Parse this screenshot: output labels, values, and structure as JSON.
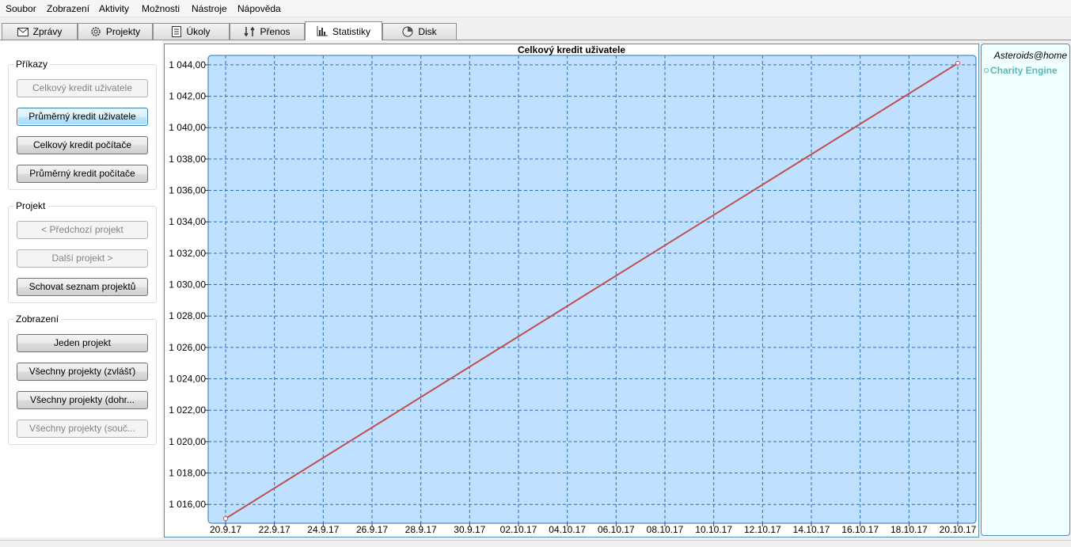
{
  "menu": [
    "Soubor",
    "Zobrazení",
    "Aktivity",
    "Možnosti",
    "Nástroje",
    "Nápověda"
  ],
  "tabs": [
    {
      "label": "Zprávy",
      "icon": "envelope-icon"
    },
    {
      "label": "Projekty",
      "icon": "gear-icon"
    },
    {
      "label": "Úkoly",
      "icon": "task-list-icon"
    },
    {
      "label": "Přenos",
      "icon": "transfer-icon"
    },
    {
      "label": "Statistiky",
      "icon": "bar-chart-icon",
      "active": true
    },
    {
      "label": "Disk",
      "icon": "disk-icon"
    }
  ],
  "commands": {
    "title": "Příkazy",
    "buttons": [
      {
        "label": "Celkový kredit uživatele",
        "state": "disabled"
      },
      {
        "label": "Průměrný kredit uživatele",
        "state": "focused"
      },
      {
        "label": "Celkový kredit počítače",
        "state": "normal"
      },
      {
        "label": "Průměrný kredit počítače",
        "state": "normal"
      }
    ]
  },
  "project": {
    "title": "Projekt",
    "buttons": [
      {
        "label": "< Předchozí projekt",
        "state": "disabled"
      },
      {
        "label": "Další projekt >",
        "state": "disabled"
      },
      {
        "label": "Schovat seznam projektů",
        "state": "normal"
      }
    ]
  },
  "view": {
    "title": "Zobrazení",
    "buttons": [
      {
        "label": "Jeden projekt",
        "state": "normal"
      },
      {
        "label": "Všechny projekty (zvlášť)",
        "state": "normal"
      },
      {
        "label": "Všechny projekty (dohr...",
        "state": "normal"
      },
      {
        "label": "Všechny projekty (souč...",
        "state": "disabled"
      }
    ]
  },
  "legend": {
    "project_name": "Asteroids@home",
    "items": [
      "Charity Engine"
    ]
  },
  "colors": {
    "plot_bg": "#bfe0ff",
    "grid": "#2f6fb3",
    "line": "#c0504d",
    "legend_text": "#5bb7b4"
  },
  "chart_data": {
    "type": "line",
    "title": "Celkový kredit uživatele",
    "xlabel": "",
    "ylabel": "",
    "x_tick_labels": [
      "20.9.17",
      "22.9.17",
      "24.9.17",
      "26.9.17",
      "28.9.17",
      "30.9.17",
      "02.10.17",
      "04.10.17",
      "06.10.17",
      "08.10.17",
      "10.10.17",
      "12.10.17",
      "14.10.17",
      "16.10.17",
      "18.10.17",
      "20.10.17"
    ],
    "y_tick_labels": [
      "1 016,00",
      "1 018,00",
      "1 020,00",
      "1 022,00",
      "1 024,00",
      "1 026,00",
      "1 028,00",
      "1 030,00",
      "1 032,00",
      "1 034,00",
      "1 036,00",
      "1 038,00",
      "1 040,00",
      "1 042,00",
      "1 044,00"
    ],
    "ylim": [
      1014.8,
      1044.6
    ],
    "grid": true,
    "series": [
      {
        "name": "Charity Engine",
        "x": [
          "20.9.17",
          "20.10.17"
        ],
        "y": [
          1015.1,
          1044.1
        ]
      }
    ]
  }
}
